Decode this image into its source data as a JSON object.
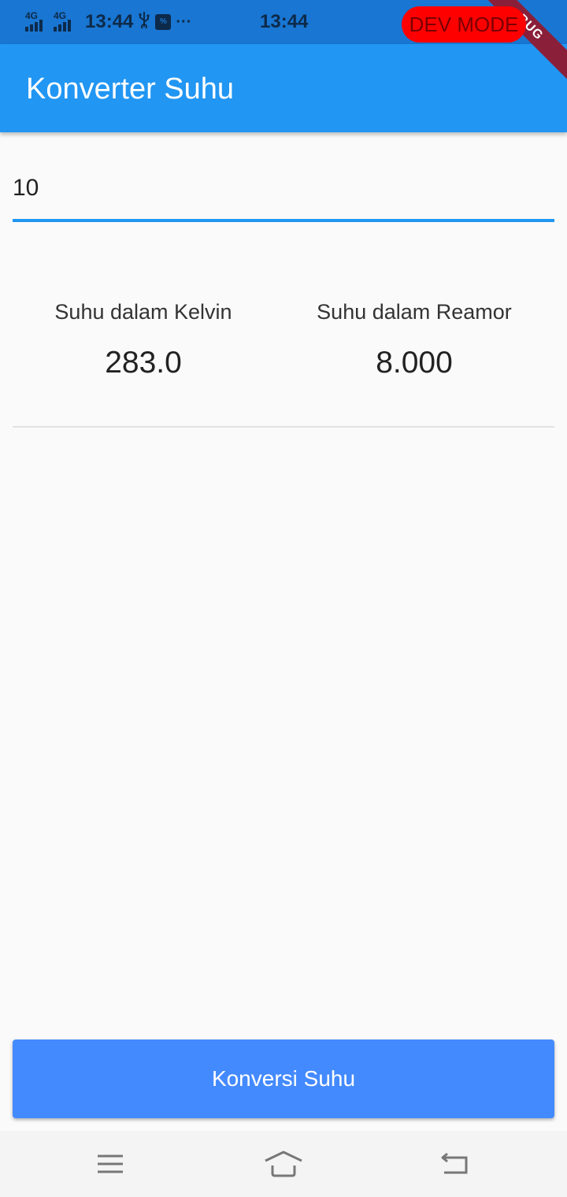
{
  "status_bar": {
    "network_1": "4G",
    "network_2": "4G",
    "time_left": "13:44",
    "time_center": "13:44",
    "dev_mode": "DEV MODE",
    "debug_banner": "BUG",
    "icons": [
      "signal-icon",
      "signal-icon",
      "usb-icon",
      "app-notification-icon",
      "more-dots-icon"
    ]
  },
  "app_bar": {
    "title": "Konverter Suhu",
    "color": "#2196f3"
  },
  "input": {
    "value": "10",
    "placeholder": ""
  },
  "results": {
    "kelvin_label": "Suhu dalam Kelvin",
    "kelvin_value": "283.0",
    "reamur_label": "Suhu dalam Reamor",
    "reamur_value": "8.000"
  },
  "button": {
    "label": "Konversi Suhu",
    "color": "#448aff"
  },
  "nav_bar": {
    "icons": [
      "menu-icon",
      "home-icon",
      "back-icon"
    ]
  }
}
